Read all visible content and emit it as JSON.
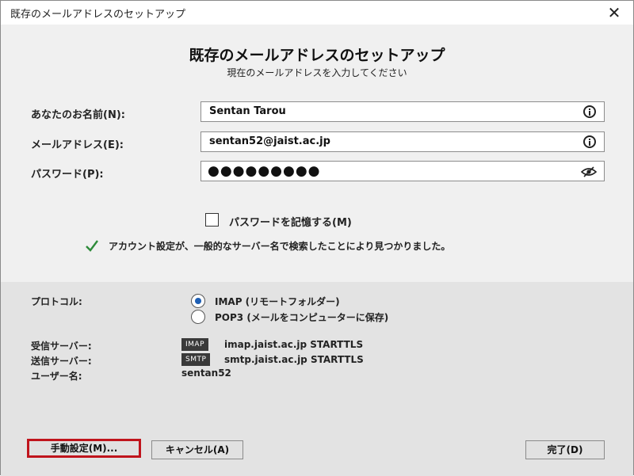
{
  "window": {
    "title": "既存のメールアドレスのセットアップ",
    "close_glyph": "✕"
  },
  "form": {
    "heading": "既存のメールアドレスのセットアップ",
    "subheading": "現在のメールアドレスを入力してください",
    "name_label": "あなたのお名前(N):",
    "name_value": "Sentan Tarou",
    "email_label": "メールアドレス(E):",
    "email_value": "sentan52@jaist.ac.jp",
    "password_label": "パスワード(P):",
    "password_value": "●●●●●●●●●",
    "remember_label": "パスワードを記憶する(M)",
    "remember_checked": false,
    "status_text": "アカウント設定が、一般的なサーバー名で検索したことにより見つかりました。"
  },
  "config": {
    "protocol_label": "プロトコル:",
    "imap_label": "IMAP (リモートフォルダー)",
    "pop3_label": "POP3 (メールをコンピューターに保存)",
    "selected_protocol": "IMAP",
    "incoming_label": "受信サーバー:",
    "incoming_badge": "IMAP",
    "incoming_server": "imap.jaist.ac.jp STARTTLS",
    "outgoing_label": "送信サーバー:",
    "outgoing_badge": "SMTP",
    "outgoing_server": "smtp.jaist.ac.jp STARTTLS",
    "username_label": "ユーザー名:",
    "username_value": "sentan52"
  },
  "buttons": {
    "manual": "手動設定(M)...",
    "cancel": "キャンセル(A)",
    "done": "完了(D)"
  },
  "colors": {
    "accent_radio": "#1e5fb4",
    "success_check": "#2e8b3a",
    "highlight_border": "#c0141c"
  }
}
